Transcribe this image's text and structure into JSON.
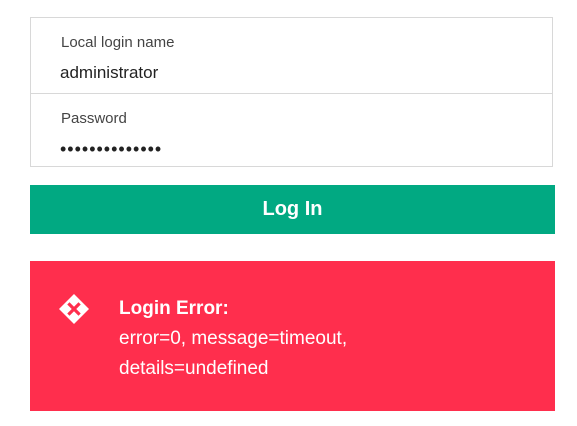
{
  "login_form": {
    "username": {
      "label": "Local login name",
      "value": "administrator"
    },
    "password": {
      "label": "Password",
      "value": "••••••••••••••"
    },
    "submit_label": "Log In"
  },
  "error": {
    "icon": "error-x-diamond-icon",
    "title": "Login Error:",
    "message_line1": "error=0, message=timeout,",
    "message_line2": "details=undefined"
  },
  "colors": {
    "button": "#01a982",
    "error": "#ff2e4d",
    "border": "#d8d8d8"
  }
}
